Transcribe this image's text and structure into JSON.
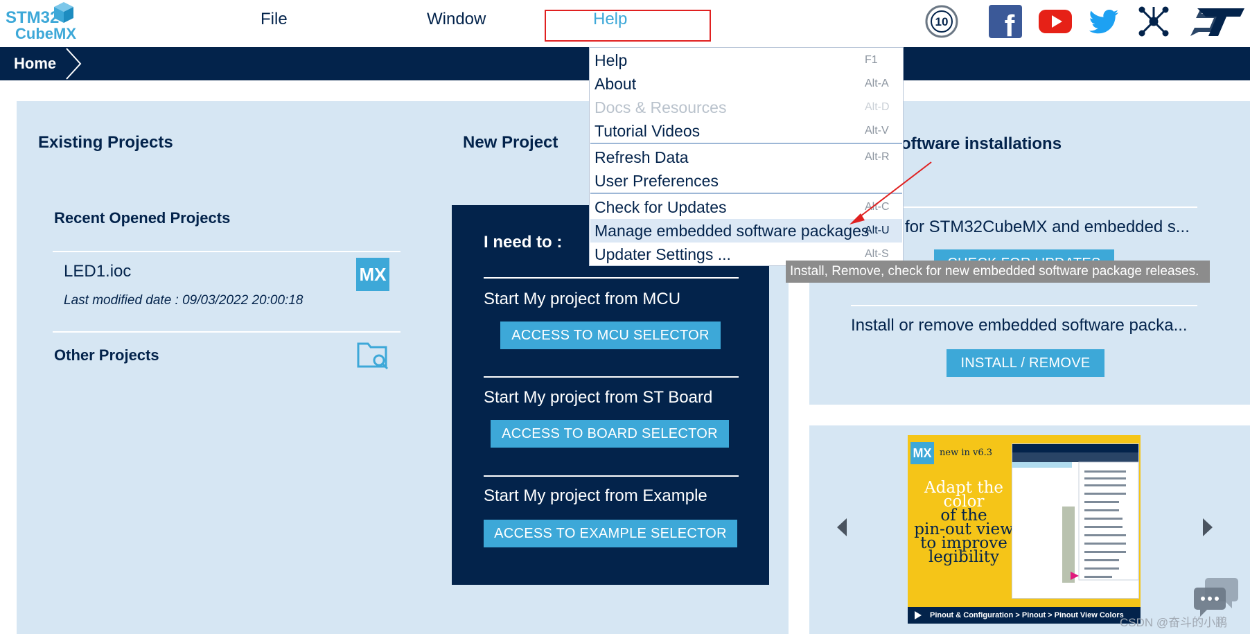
{
  "app": {
    "logo_line1": "STM32",
    "logo_line2": "CubeMX"
  },
  "menubar": {
    "items": [
      "File",
      "Window",
      "Help"
    ]
  },
  "social_icons": [
    "anniversary-10-icon",
    "facebook-icon",
    "youtube-icon",
    "twitter-icon",
    "network-icon",
    "st-logo-icon"
  ],
  "breadcrumb": {
    "home": "Home"
  },
  "existing_projects": {
    "title": "Existing Projects",
    "recent_title": "Recent Opened Projects",
    "recent": [
      {
        "name": "LED1.ioc",
        "date": "Last modified date : 09/03/2022 20:00:18",
        "badge": "MX"
      }
    ],
    "other_title": "Other Projects"
  },
  "new_project": {
    "title": "New Project",
    "need_to": "I need to :",
    "sections": [
      {
        "label": "Start My project from MCU",
        "button": "ACCESS TO MCU SELECTOR"
      },
      {
        "label": "Start My project from ST Board",
        "button": "ACCESS TO BOARD SELECTOR"
      },
      {
        "label": "Start My project from Example",
        "button": "ACCESS TO EXAMPLE SELECTOR"
      }
    ]
  },
  "software": {
    "title_partial": "oftware installations",
    "check_text": "for STM32CubeMX and embedded s...",
    "check_button": "CHECK FOR UPDATES",
    "install_text": "Install or remove embedded software packa...",
    "install_button": "INSTALL / REMOVE"
  },
  "help_menu": {
    "items": [
      {
        "label": "Help",
        "shortcut": "F1",
        "disabled": false
      },
      {
        "label": "About",
        "shortcut": "Alt-A",
        "disabled": false
      },
      {
        "label": "Docs & Resources",
        "shortcut": "Alt-D",
        "disabled": true
      },
      {
        "label": "Tutorial Videos",
        "shortcut": "Alt-V",
        "disabled": false
      },
      {
        "label": "Refresh Data",
        "shortcut": "Alt-R",
        "disabled": false
      },
      {
        "label": "User Preferences",
        "shortcut": "",
        "disabled": false
      },
      {
        "label": "Check for Updates",
        "shortcut": "Alt-C",
        "disabled": false
      },
      {
        "label": "Manage embedded software packages",
        "shortcut": "Alt-U",
        "disabled": false,
        "highlighted": true
      },
      {
        "label": "Updater Settings ...",
        "shortcut": "Alt-S",
        "disabled": false
      }
    ],
    "tooltip": "Install, Remove, check for new embedded software package releases."
  },
  "carousel": {
    "badge": "MX",
    "new_in": "new in v6.3",
    "headline_1": "Adapt the",
    "headline_2": "color",
    "headline_3": "of the",
    "headline_4": "pin-out view",
    "headline_5": "to improve",
    "headline_6": "legibility",
    "footer": "Pinout & Configuration > Pinout > Pinout View Colors"
  },
  "watermark": "CSDN @奋斗的小鹏",
  "colors": {
    "navy": "#03234b",
    "accent": "#3da8d8",
    "panel": "#d6e6f3",
    "annotation_red": "#e02020"
  }
}
